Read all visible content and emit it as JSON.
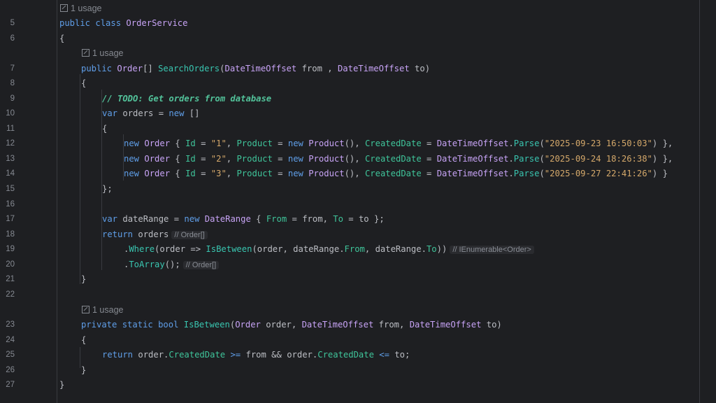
{
  "usage_label": "1 usage",
  "line_numbers": [
    "5",
    "6",
    "7",
    "8",
    "9",
    "10",
    "11",
    "12",
    "13",
    "14",
    "15",
    "16",
    "17",
    "18",
    "19",
    "20",
    "21",
    "22",
    "23",
    "24",
    "25",
    "26",
    "27"
  ],
  "code": {
    "class_decl": [
      "public",
      "class",
      "OrderService"
    ],
    "open_brace": "{",
    "close_brace": "}",
    "search_sig": [
      "public",
      "Order",
      "[] ",
      "SearchOrders",
      "(",
      "DateTimeOffset",
      "from",
      " , ",
      "DateTimeOffset",
      "to",
      ")"
    ],
    "todo_comment": "// TODO: Get orders from database",
    "orders_decl": [
      "var",
      "orders",
      " = ",
      "new",
      " []"
    ],
    "order_rows": [
      {
        "id": "\"1\"",
        "date": "\"2025-09-23 16:50:03\"",
        "end": " },"
      },
      {
        "id": "\"2\"",
        "date": "\"2025-09-24 18:26:38\"",
        "end": " },"
      },
      {
        "id": "\"3\"",
        "date": "\"2025-09-27 22:41:26\"",
        "end": " }"
      }
    ],
    "row_tokens": [
      "new",
      "Order",
      "Id",
      "Product",
      "new",
      "Product",
      "CreatedDate",
      "DateTimeOffset",
      "Parse"
    ],
    "close_array": "};",
    "daterange_decl": [
      "var",
      "dateRange",
      "new",
      "DateRange",
      "From",
      "from",
      "To",
      "to"
    ],
    "return_orders": [
      "return",
      "orders"
    ],
    "where_line": [
      ".",
      "Where",
      "(order => ",
      "IsBetween",
      "(order, dateRange.",
      "From",
      ", dateRange.",
      "To",
      "))"
    ],
    "toarray_line": [
      ".",
      "ToArray",
      "();"
    ],
    "isbetween_sig": [
      "private",
      "static",
      "bool",
      "IsBetween",
      "(",
      "Order",
      " order, ",
      "DateTimeOffset",
      " from, ",
      "DateTimeOffset",
      " to)"
    ],
    "return_compare": [
      "return",
      "order.",
      "CreatedDate",
      ">=",
      "from && order.",
      "CreatedDate",
      "<=",
      "to;"
    ]
  },
  "inlay_hints": {
    "orders_type": "// Order[]",
    "where_type": "// IEnumerable<Order>",
    "toarray_type": "// Order[]"
  },
  "colors": {
    "background": "#1e1f22",
    "keyword": "#5f9ee8",
    "type": "#c7a3f5",
    "method": "#39c5b0",
    "property": "#3fc49a",
    "string": "#d4a86a",
    "comment": "#52c29a",
    "line_number": "#858991"
  }
}
